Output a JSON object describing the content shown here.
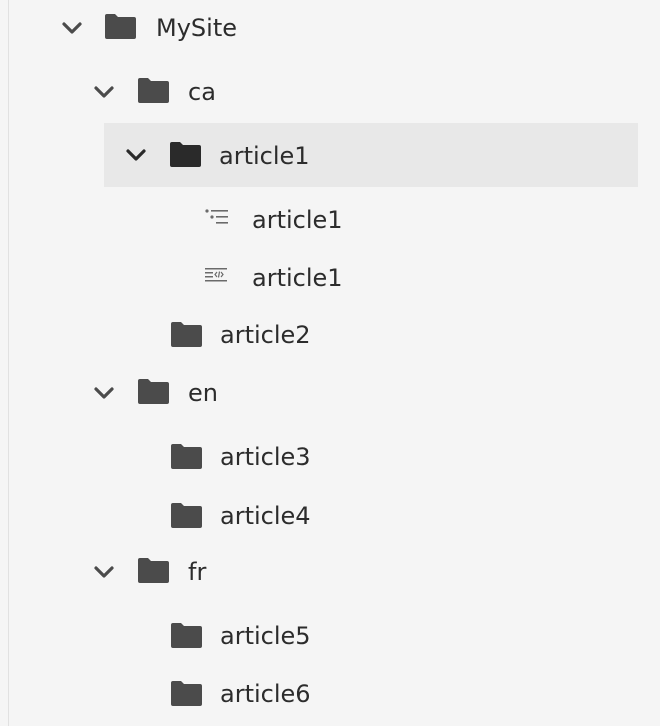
{
  "tree": {
    "root": {
      "label": "MySite",
      "expanded": true,
      "icon": "folder-icon"
    },
    "ca": {
      "label": "ca",
      "expanded": true,
      "icon": "folder-icon"
    },
    "ca_article1": {
      "label": "article1",
      "expanded": true,
      "selected": true,
      "icon": "folder-icon"
    },
    "ca_article1_outline": {
      "label": "article1",
      "icon": "outline-list-icon"
    },
    "ca_article1_source": {
      "label": "article1",
      "icon": "code-document-icon"
    },
    "ca_article2": {
      "label": "article2",
      "icon": "folder-icon"
    },
    "en": {
      "label": "en",
      "expanded": true,
      "icon": "folder-icon"
    },
    "en_article3": {
      "label": "article3",
      "icon": "folder-icon"
    },
    "en_article4": {
      "label": "article4",
      "icon": "folder-icon"
    },
    "fr": {
      "label": "fr",
      "expanded": true,
      "icon": "folder-icon"
    },
    "fr_article5": {
      "label": "article5",
      "icon": "folder-icon"
    },
    "fr_article6": {
      "label": "article6",
      "icon": "folder-icon"
    }
  },
  "colors": {
    "background": "#f5f5f5",
    "selected_row": "#e8e8e8",
    "folder": "#4b4b4b",
    "folder_selected": "#2a2a2a",
    "text": "#2c2c2c"
  }
}
